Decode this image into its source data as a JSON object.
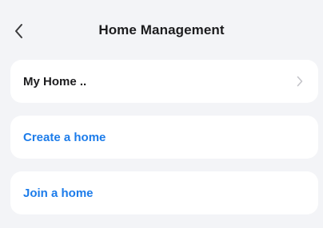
{
  "header": {
    "back_icon": "chevron-left-icon",
    "title": "Home Management"
  },
  "homes": [
    {
      "label": "My Home ..",
      "icon": "chevron-right-icon"
    }
  ],
  "actions": {
    "create_label": "Create a home",
    "join_label": "Join a home"
  },
  "colors": {
    "background": "#f3f4f7",
    "card": "#ffffff",
    "text": "#1c1c1e",
    "accent": "#1c7cea",
    "chevron": "#c4c4c9"
  }
}
